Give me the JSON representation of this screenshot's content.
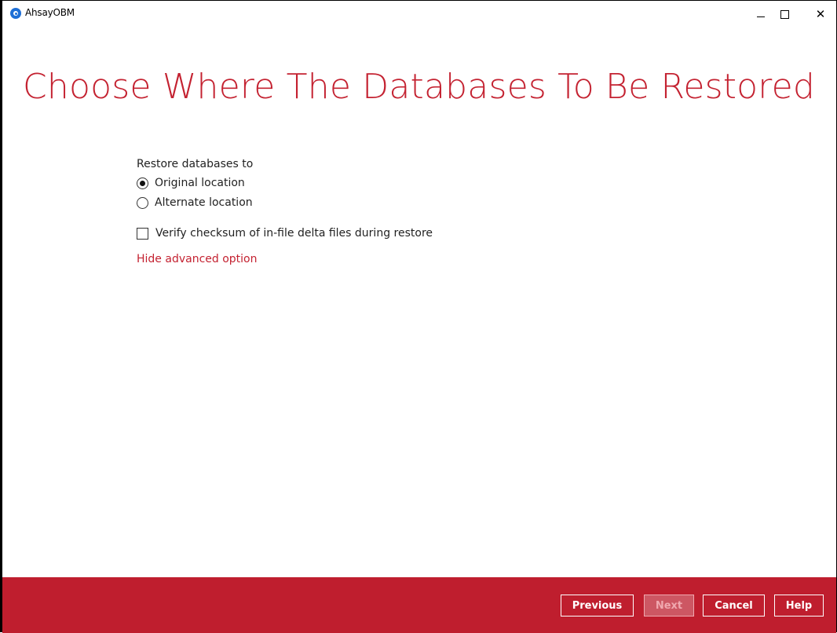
{
  "window": {
    "title": "AhsayOBM",
    "controls": {
      "minimize_icon": "minimize-icon",
      "maximize_icon": "maximize-icon",
      "close_icon": "close-icon",
      "close_glyph": "✕"
    }
  },
  "page": {
    "heading": "Choose Where The Databases To Be Restored"
  },
  "restore": {
    "group_label": "Restore databases to",
    "options": [
      {
        "label": "Original location",
        "selected": true
      },
      {
        "label": "Alternate location",
        "selected": false
      }
    ],
    "verify_checksum": {
      "label": "Verify checksum of in-file delta files during restore",
      "checked": false
    },
    "advanced_link": "Hide advanced option"
  },
  "footer": {
    "previous_label": "Previous",
    "next_label": "Next",
    "next_enabled": false,
    "cancel_label": "Cancel",
    "help_label": "Help"
  },
  "colors": {
    "accent": "#c42231",
    "footer_bg": "#bf1e2e",
    "app_icon": "#1e6fd6"
  }
}
